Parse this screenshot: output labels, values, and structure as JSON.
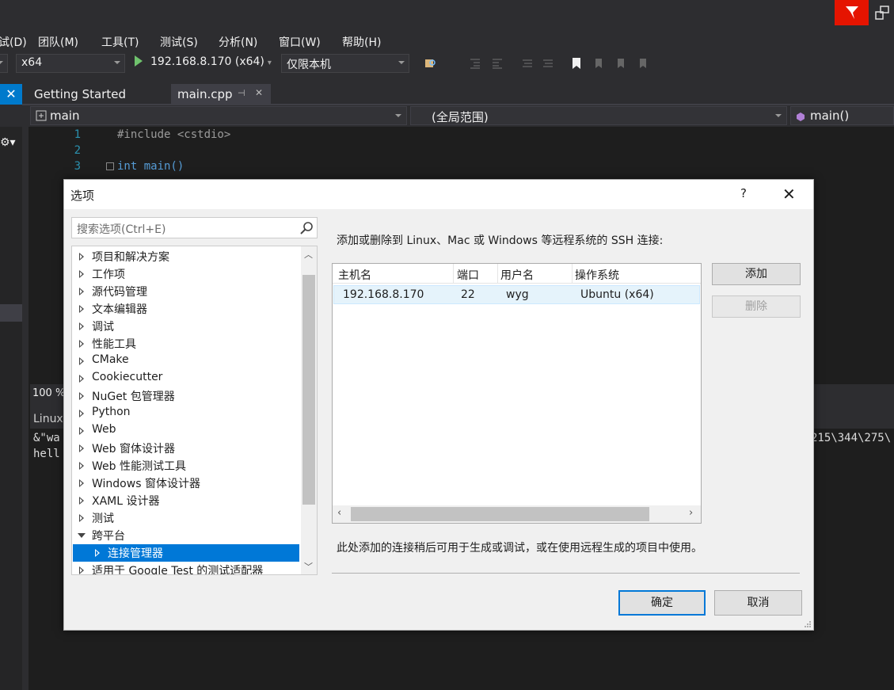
{
  "menubar": {
    "items": [
      "试(D)",
      "团队(M)",
      "工具(T)",
      "测试(S)",
      "分析(N)",
      "窗口(W)",
      "帮助(H)"
    ]
  },
  "toolbar": {
    "platform": "x64",
    "run_target": "192.168.8.170 (x64)",
    "machine_combo": "仅限本机"
  },
  "tabs": {
    "getting_started": "Getting Started",
    "main_cpp": "main.cpp",
    "pin": "⊣",
    "close": "✕",
    "left_close": "✕"
  },
  "navbar": {
    "project": "main",
    "scope": "(全局范围)",
    "function": "main()"
  },
  "editor": {
    "lines": [
      {
        "num": "1",
        "code": "#include <cstdio>"
      },
      {
        "num": "2",
        "code": ""
      },
      {
        "num": "3",
        "code": "int main()"
      }
    ]
  },
  "status": {
    "zoom": "100 %"
  },
  "output": {
    "header": "Linux",
    "line1": "&\"wa",
    "line2": "hell",
    "line1_tail": "215\\344\\275\\"
  },
  "dialog": {
    "title": "选项",
    "help": "?",
    "close": "✕",
    "search_placeholder": "搜索选项(Ctrl+E)",
    "tree": [
      {
        "label": "项目和解决方案",
        "state": "closed"
      },
      {
        "label": "工作项",
        "state": "closed"
      },
      {
        "label": "源代码管理",
        "state": "closed"
      },
      {
        "label": "文本编辑器",
        "state": "closed"
      },
      {
        "label": "调试",
        "state": "closed"
      },
      {
        "label": "性能工具",
        "state": "closed"
      },
      {
        "label": "CMake",
        "state": "closed"
      },
      {
        "label": "Cookiecutter",
        "state": "closed"
      },
      {
        "label": "NuGet 包管理器",
        "state": "closed"
      },
      {
        "label": "Python",
        "state": "closed"
      },
      {
        "label": "Web",
        "state": "closed"
      },
      {
        "label": "Web 窗体设计器",
        "state": "closed"
      },
      {
        "label": "Web 性能测试工具",
        "state": "closed"
      },
      {
        "label": "Windows 窗体设计器",
        "state": "closed"
      },
      {
        "label": "XAML 设计器",
        "state": "closed"
      },
      {
        "label": "测试",
        "state": "closed"
      },
      {
        "label": "跨平台",
        "state": "open"
      },
      {
        "label": "连接管理器",
        "state": "selected"
      },
      {
        "label": "适用于 Google Test 的测试适配器",
        "state": "closed"
      }
    ],
    "description": "添加或删除到 Linux、Mac 或 Windows 等远程系统的 SSH 连接:",
    "columns": [
      "主机名",
      "端口",
      "用户名",
      "操作系统"
    ],
    "rows": [
      {
        "host": "192.168.8.170",
        "port": "22",
        "user": "wyg",
        "os": "Ubuntu (x64)"
      }
    ],
    "add_button": "添加",
    "remove_button": "删除",
    "note": "此处添加的连接稍后可用于生成或调试，或在使用远程生成的项目中使用。",
    "ok_button": "确定",
    "cancel_button": "取消"
  }
}
